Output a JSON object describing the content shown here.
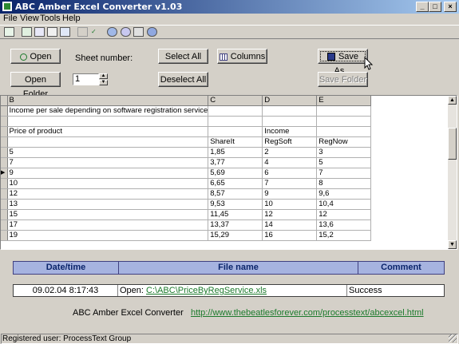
{
  "window": {
    "title": "ABC Amber Excel Converter v1.03",
    "controls": [
      "_",
      "□",
      "×"
    ]
  },
  "menu": [
    "File",
    "View",
    "Tools",
    "Help"
  ],
  "toolbar_icons": [
    "new-icon",
    "open-icon",
    "convert-icon",
    "print-icon",
    "print-preview-icon",
    "cut-icon",
    "spell-icon",
    "settings-icon",
    "help-icon",
    "email-icon",
    "web-icon"
  ],
  "controls": {
    "open_label": "Open",
    "open_folder_label": "Open Folder",
    "sheet_number_label": "Sheet number:",
    "sheet_number_value": "1",
    "select_all_label": "Select All",
    "deselect_all_label": "Deselect All",
    "columns_label": "Columns",
    "save_as_label": "Save As...",
    "save_folder_label": "Save Folder"
  },
  "grid": {
    "columns": [
      "B",
      "C",
      "D",
      "E"
    ],
    "rows": [
      [
        "Income per sale depending on software registration service",
        "",
        "",
        ""
      ],
      [
        "",
        "",
        "",
        ""
      ],
      [
        "Price of product",
        "",
        "Income",
        ""
      ],
      [
        "",
        "ShareIt",
        "RegSoft",
        "RegNow"
      ],
      [
        "5",
        "1,85",
        "2",
        "3"
      ],
      [
        "7",
        "3,77",
        "4",
        "5"
      ],
      [
        "9",
        "5,69",
        "6",
        "7"
      ],
      [
        "10",
        "6,65",
        "7",
        "8"
      ],
      [
        "12",
        "8,57",
        "9",
        "9,6"
      ],
      [
        "13",
        "9,53",
        "10",
        "10,4"
      ],
      [
        "15",
        "11,45",
        "12",
        "12"
      ],
      [
        "17",
        "13,37",
        "14",
        "13,6"
      ],
      [
        "19",
        "15,29",
        "16",
        "15,2"
      ]
    ],
    "current_row_marker": "▶"
  },
  "log": {
    "headers": {
      "datetime": "Date/time",
      "filename": "File name",
      "comment": "Comment"
    },
    "entry": {
      "datetime": "09.02.04 8:17:43",
      "action": "Open:",
      "file": "C:\\ABC\\PriceByRegService.xls",
      "comment": "Success"
    }
  },
  "footer": {
    "product": "ABC Amber Excel Converter",
    "url": "http://www.thebeatlesforever.com/processtext/abcexcel.html"
  },
  "status": {
    "text": "Registered user: ProcessText Group"
  }
}
